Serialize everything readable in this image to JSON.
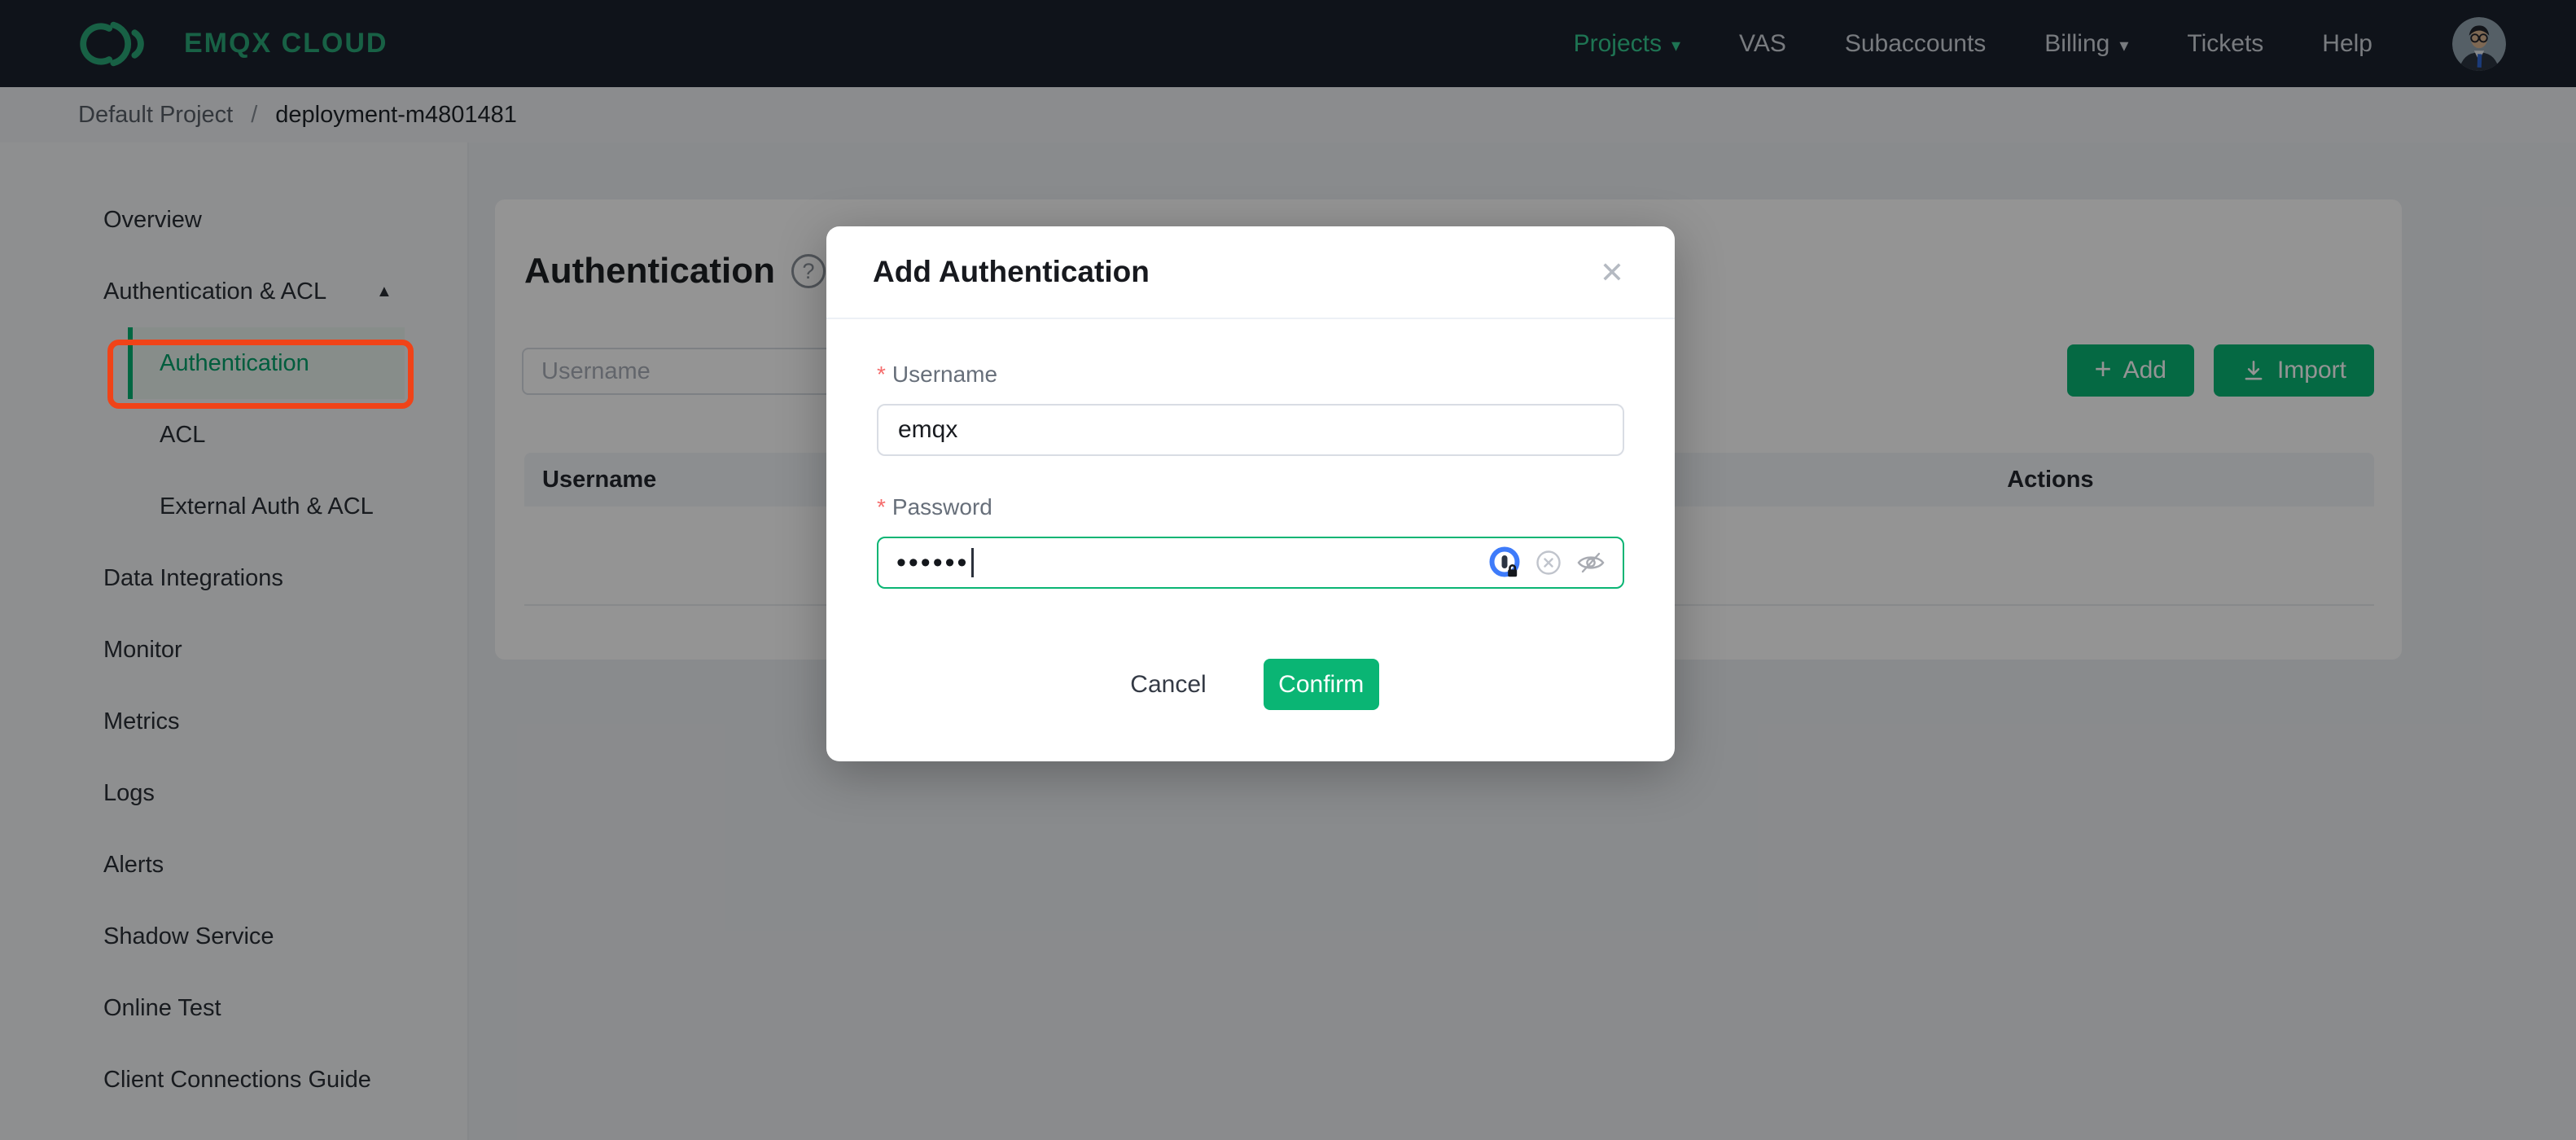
{
  "navbar": {
    "brand": "EMQX CLOUD",
    "items": [
      {
        "label": "Projects",
        "caret": "▾",
        "active": true
      },
      {
        "label": "VAS"
      },
      {
        "label": "Subaccounts"
      },
      {
        "label": "Billing",
        "caret": "▾"
      },
      {
        "label": "Tickets"
      },
      {
        "label": "Help"
      }
    ]
  },
  "breadcrumb": {
    "project": "Default Project",
    "separator": "/",
    "deployment": "deployment-m4801481"
  },
  "sidebar": {
    "items": [
      {
        "label": "Overview"
      },
      {
        "label": "Authentication & ACL",
        "caret": "▲"
      },
      {
        "label": "Authentication",
        "sub": true,
        "active": true
      },
      {
        "label": "ACL",
        "sub": true
      },
      {
        "label": "External Auth & ACL",
        "sub": true
      },
      {
        "label": "Data Integrations"
      },
      {
        "label": "Monitor"
      },
      {
        "label": "Metrics"
      },
      {
        "label": "Logs"
      },
      {
        "label": "Alerts"
      },
      {
        "label": "Shadow Service"
      },
      {
        "label": "Online Test"
      },
      {
        "label": "Client Connections Guide"
      }
    ]
  },
  "main": {
    "title": "Authentication",
    "help_icon": "?",
    "search_placeholder": "Username",
    "add_label": "Add",
    "add_icon": "+",
    "import_label": "Import",
    "table": {
      "columns": [
        "Username",
        "Actions"
      ]
    }
  },
  "modal": {
    "title": "Add Authentication",
    "close_icon": "✕",
    "required_marker": "*",
    "username_label": "Username",
    "username_value": "emqx",
    "password_label": "Password",
    "password_masked": "••••••",
    "cancel_label": "Cancel",
    "confirm_label": "Confirm"
  },
  "colors": {
    "accent_green": "#0AB574",
    "sidebar_active_green": "#00B173",
    "navbar_green": "#35C98F",
    "annotation_red": "#F04318",
    "navbar_bg": "#1B212D"
  }
}
